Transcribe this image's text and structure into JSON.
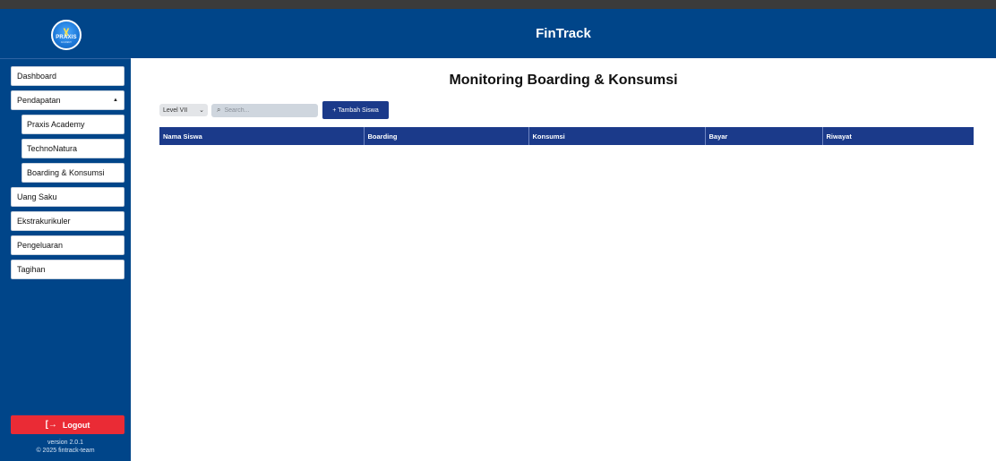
{
  "app": {
    "title": "FinTrack",
    "logo_text": "PRAXIS",
    "logo_sub": "ACADEMY"
  },
  "sidebar": {
    "items": [
      {
        "label": "Dashboard"
      },
      {
        "label": "Pendapatan",
        "caret": "▲"
      },
      {
        "label": "Praxis Academy"
      },
      {
        "label": "TechnoNatura"
      },
      {
        "label": "Boarding & Konsumsi"
      },
      {
        "label": "Uang Saku"
      },
      {
        "label": "Ekstrakurikuler"
      },
      {
        "label": "Pengeluaran"
      },
      {
        "label": "Tagihan"
      }
    ],
    "logout_label": "Logout",
    "version": "version 2.0.1",
    "copyright": "© 2025 fintrack-team"
  },
  "main": {
    "page_title": "Monitoring Boarding & Konsumsi",
    "level_select": {
      "value": "Level VII"
    },
    "search": {
      "placeholder": "Search..."
    },
    "add_button": "+ Tambah Siswa",
    "table": {
      "columns": [
        "Nama Siswa",
        "Boarding",
        "Konsumsi",
        "Bayar",
        "Riwayat"
      ]
    }
  },
  "colors": {
    "primary": "#004589",
    "table_header": "#1b3a8a",
    "logout": "#ea2b35"
  },
  "icons": {
    "search": "search-icon",
    "logout": "logout-icon",
    "select": "chevron-down-icon",
    "expand": "caret-up-icon"
  }
}
